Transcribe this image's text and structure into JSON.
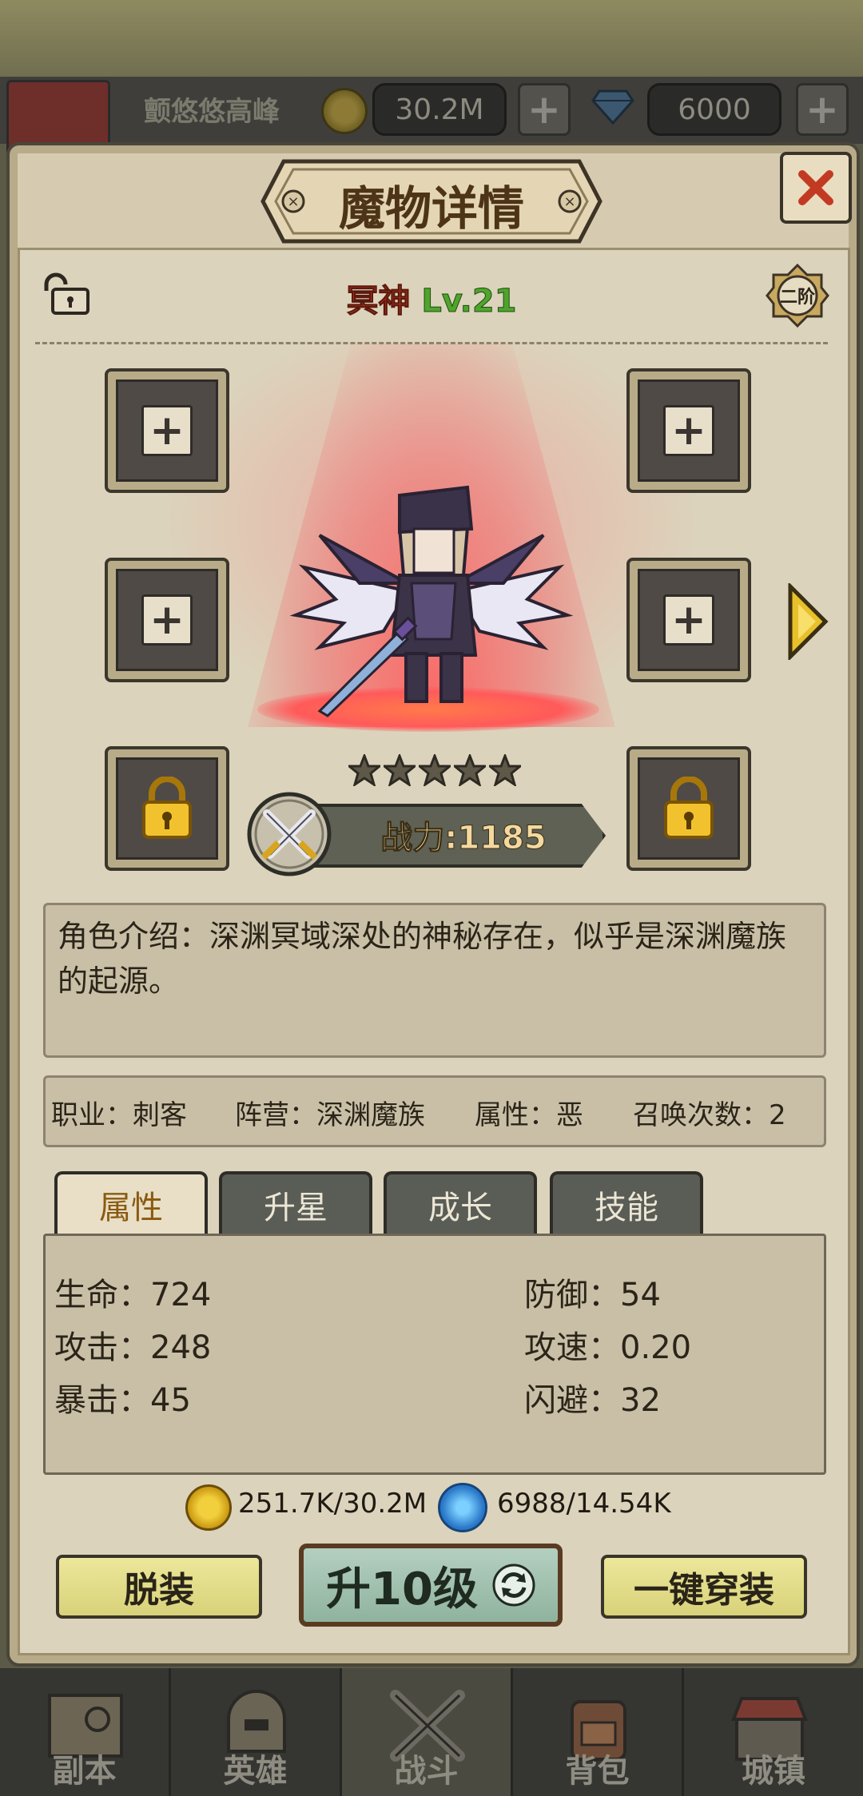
{
  "topbar": {
    "player_name": "颤悠悠高峰",
    "gold": "30.2M",
    "gems": "6000",
    "plus_gold": "+",
    "plus_gems": "+"
  },
  "panel": {
    "title": "魔物详情",
    "close_label": "✕",
    "monster_name": "冥神",
    "monster_level": "Lv.21",
    "rank_badge": "二阶",
    "stars": 5,
    "power_label": "战力:1185",
    "slot_plus": "+",
    "intro": "角色介绍：深渊冥域深处的神秘存在，似乎是深渊魔族的起源。",
    "info": {
      "profession": "职业：刺客",
      "faction": "阵营：深渊魔族",
      "attribute": "属性：恶",
      "summons": "召唤次数：2"
    },
    "tabs": [
      "属性",
      "升星",
      "成长",
      "技能"
    ],
    "stats": {
      "hp": "生命：724",
      "atk": "攻击：248",
      "crit": "暴击：45",
      "def": "防御：54",
      "atk_speed": "攻速：0.20",
      "dodge": "闪避：32"
    },
    "cost_gold": "251.7K/30.2M",
    "cost_exp": "6988/14.54K",
    "btn_unequip": "脱装",
    "btn_level": "升10级",
    "btn_equip_all": "一键穿装"
  },
  "nav": [
    "副本",
    "英雄",
    "战斗",
    "背包",
    "城镇"
  ],
  "colors": {
    "name_red": "#d6381e",
    "level_green": "#4fa52c",
    "tab_active_text": "#8a5a10",
    "panel_bg": "#d6cbb1"
  }
}
